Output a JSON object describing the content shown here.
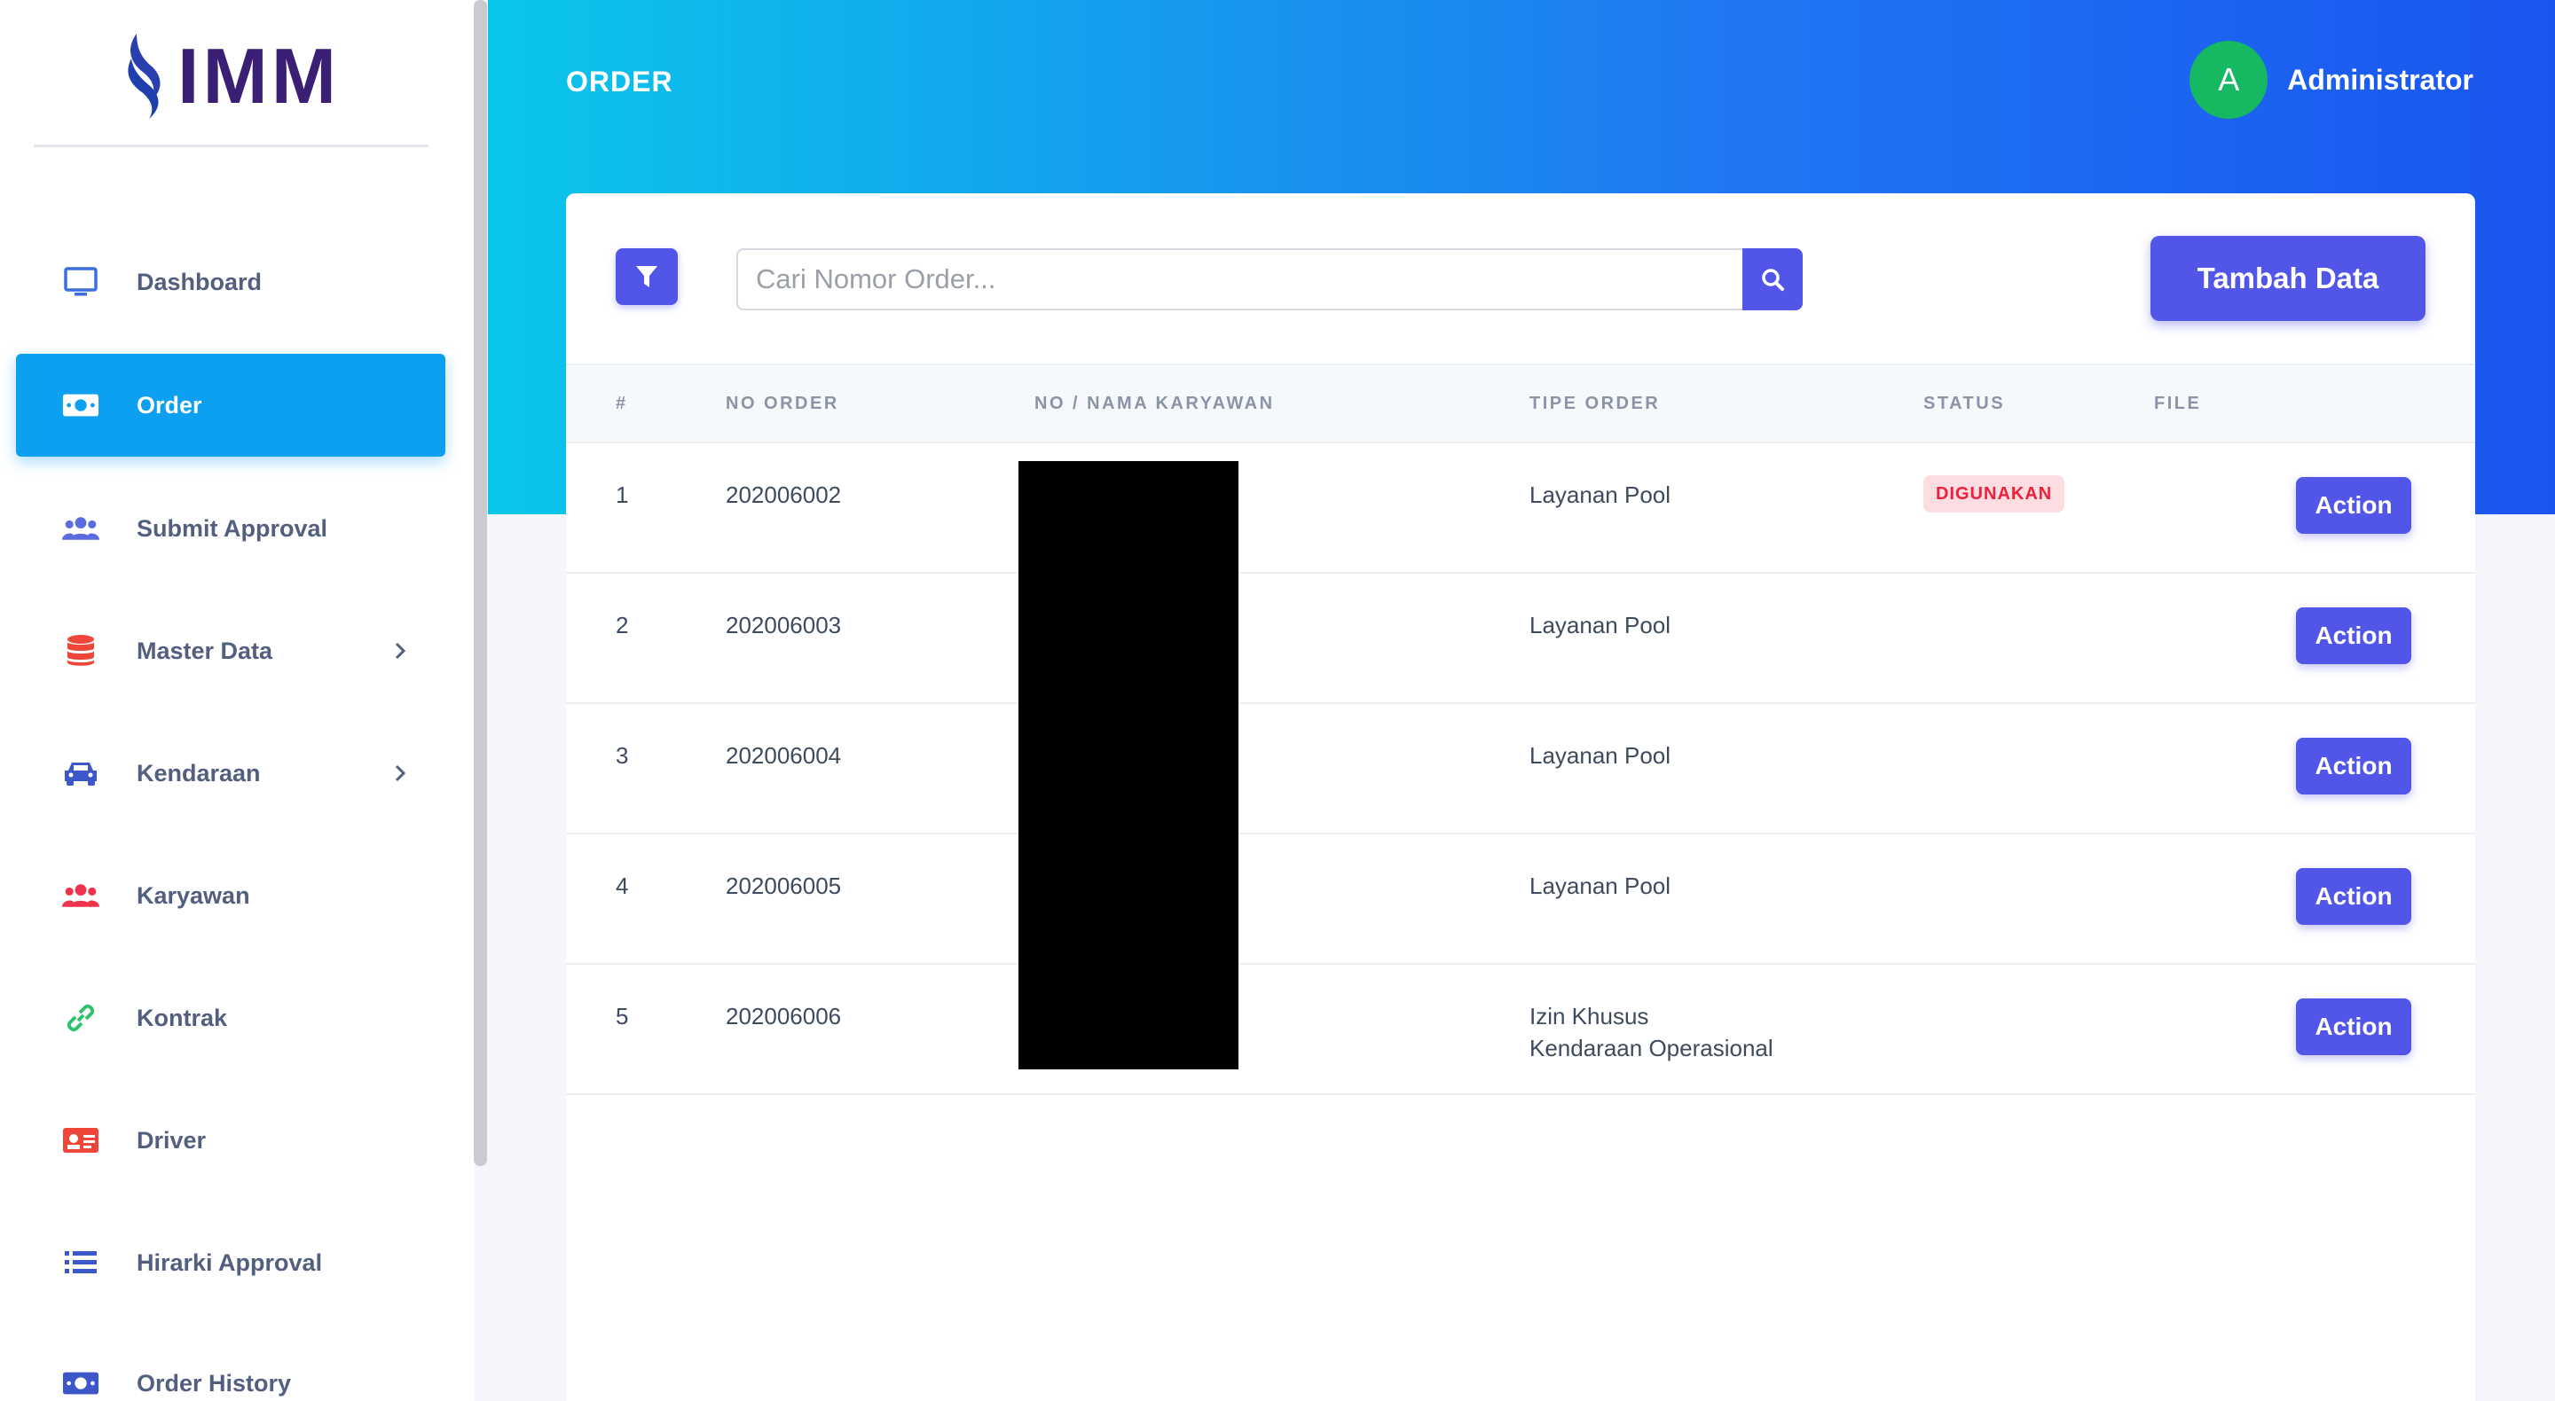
{
  "brand": {
    "name": "IMM",
    "color": "#3b1f74",
    "accent": "#1f3fae"
  },
  "header": {
    "title": "ORDER",
    "user": {
      "initial": "A",
      "name": "Administrator"
    }
  },
  "sidebar": {
    "items": [
      {
        "label": "Dashboard",
        "icon": "monitor-icon",
        "active": false,
        "has_submenu": false
      },
      {
        "label": "Order",
        "icon": "money-icon",
        "active": true,
        "has_submenu": false
      },
      {
        "label": "Submit Approval",
        "icon": "users-icon",
        "active": false,
        "has_submenu": false
      },
      {
        "label": "Master Data",
        "icon": "database-icon",
        "active": false,
        "has_submenu": true
      },
      {
        "label": "Kendaraan",
        "icon": "car-icon",
        "active": false,
        "has_submenu": true
      },
      {
        "label": "Karyawan",
        "icon": "users-icon",
        "active": false,
        "has_submenu": false
      },
      {
        "label": "Kontrak",
        "icon": "link-icon",
        "active": false,
        "has_submenu": false
      },
      {
        "label": "Driver",
        "icon": "id-card-icon",
        "active": false,
        "has_submenu": false
      },
      {
        "label": "Hirarki Approval",
        "icon": "list-icon",
        "active": false,
        "has_submenu": false
      },
      {
        "label": "Order History",
        "icon": "money-icon",
        "active": false,
        "has_submenu": false
      }
    ]
  },
  "toolbar": {
    "search_placeholder": "Cari Nomor Order...",
    "add_label": "Tambah Data"
  },
  "table": {
    "columns": [
      "#",
      "NO ORDER",
      "NO / NAMA KARYAWAN",
      "TIPE ORDER",
      "STATUS",
      "FILE"
    ],
    "rows": [
      {
        "no": "1",
        "order": "202006002",
        "employee": "",
        "type_line1": "Layanan Pool",
        "type_line2": "",
        "status": "DIGUNAKAN",
        "file": "",
        "action": "Action"
      },
      {
        "no": "2",
        "order": "202006003",
        "employee": "",
        "type_line1": "Layanan Pool",
        "type_line2": "",
        "status": "",
        "file": "",
        "action": "Action"
      },
      {
        "no": "3",
        "order": "202006004",
        "employee": "",
        "type_line1": "Layanan Pool",
        "type_line2": "",
        "status": "",
        "file": "",
        "action": "Action"
      },
      {
        "no": "4",
        "order": "202006005",
        "employee": "",
        "type_line1": "Layanan Pool",
        "type_line2": "",
        "status": "",
        "file": "",
        "action": "Action"
      },
      {
        "no": "5",
        "order": "202006006",
        "employee": "",
        "type_line1": "Izin Khusus",
        "type_line2": "Kendaraan Operasional",
        "status": "",
        "file": "",
        "action": "Action"
      }
    ]
  },
  "colors": {
    "primary": "#5256e8",
    "active_nav": "#0d9ff0",
    "danger": "#f0203a",
    "success": "#16b862"
  }
}
